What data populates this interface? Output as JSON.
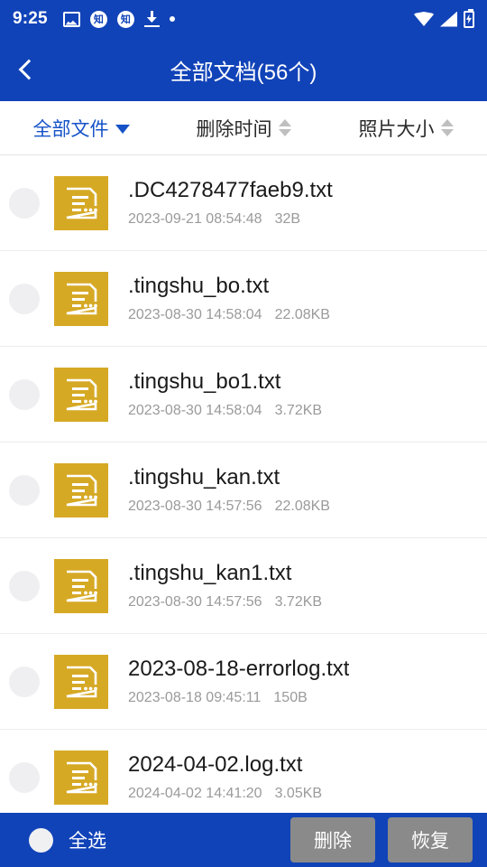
{
  "colors": {
    "brand_blue": "#1143B8",
    "file_icon_gold": "#D6A925",
    "filter_active_blue": "#1552C8",
    "action_button_gray": "#8A8A8A"
  },
  "status_bar": {
    "time": "9:25",
    "left_icons": [
      "image-icon",
      "zhihu-icon",
      "zhihu-icon",
      "download-icon",
      "dot-icon"
    ],
    "zhihu_glyph": "知",
    "right_icons": [
      "wifi-icon",
      "signal-icon",
      "battery-charging-icon"
    ]
  },
  "title_bar": {
    "back_icon": "back-chevron-icon",
    "title": "全部文档(56个)"
  },
  "filter_bar": {
    "items": [
      {
        "label": "全部文件",
        "icon": "chevron-down-icon",
        "active": true
      },
      {
        "label": "删除时间",
        "icon": "sort-arrows-icon",
        "active": false
      },
      {
        "label": "照片大小",
        "icon": "sort-arrows-icon",
        "active": false
      }
    ]
  },
  "file_list": {
    "rows": [
      {
        "name": ".DC4278477faeb9.txt",
        "date": "2023-09-21 08:54:48",
        "size": "32B",
        "checked": false
      },
      {
        "name": ".tingshu_bo.txt",
        "date": "2023-08-30 14:58:04",
        "size": "22.08KB",
        "checked": false
      },
      {
        "name": ".tingshu_bo1.txt",
        "date": "2023-08-30 14:58:04",
        "size": "3.72KB",
        "checked": false
      },
      {
        "name": ".tingshu_kan.txt",
        "date": "2023-08-30 14:57:56",
        "size": "22.08KB",
        "checked": false
      },
      {
        "name": ".tingshu_kan1.txt",
        "date": "2023-08-30 14:57:56",
        "size": "3.72KB",
        "checked": false
      },
      {
        "name": "2023-08-18-errorlog.txt",
        "date": "2023-08-18 09:45:11",
        "size": "150B",
        "checked": false
      },
      {
        "name": "2024-04-02.log.txt",
        "date": "2024-04-02 14:41:20",
        "size": "3.05KB",
        "checked": false
      }
    ]
  },
  "bottom_bar": {
    "select_all_label": "全选",
    "select_all_checked": false,
    "delete_label": "删除",
    "restore_label": "恢复"
  }
}
